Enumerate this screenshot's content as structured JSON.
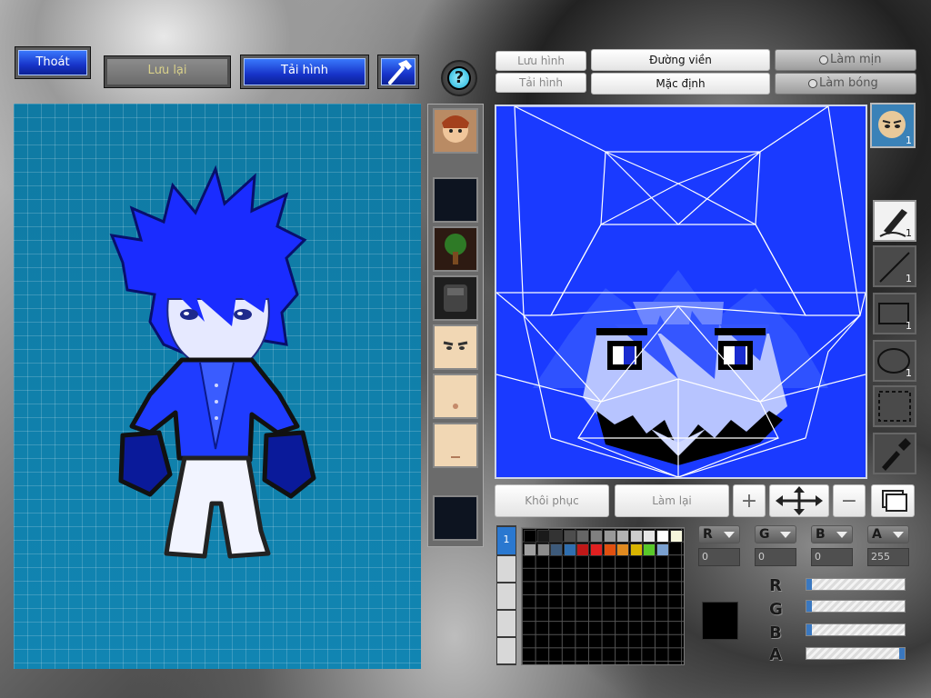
{
  "toolbar": {
    "exit_label": "Thoát",
    "save_label": "Lưu lại",
    "load_label": "Tải hình",
    "help_glyph": "?"
  },
  "editor": {
    "save_image_label": "Lưu hình",
    "load_image_label": "Tải hình",
    "outline_label": "Đường viền",
    "default_label": "Mặc định",
    "smooth_label": "Làm mịn",
    "shadow_label": "Làm bóng",
    "restore_label": "Khôi phục",
    "redo_label": "Làm lại",
    "plus_glyph": "+",
    "minus_glyph": "−"
  },
  "tools": [
    {
      "icon": "pen-icon",
      "count": "1"
    },
    {
      "icon": "line-icon",
      "count": "1"
    },
    {
      "icon": "rectangle-icon",
      "count": "1"
    },
    {
      "icon": "ellipse-icon",
      "count": "1"
    },
    {
      "icon": "selection-icon",
      "count": ""
    },
    {
      "icon": "eyedropper-icon",
      "count": ""
    }
  ],
  "face_badge_count": "1",
  "layer_tab_label": "1",
  "color": {
    "r_label": "R",
    "g_label": "G",
    "b_label": "B",
    "a_label": "A",
    "r_value": "0",
    "g_value": "0",
    "b_value": "0",
    "a_value": "255",
    "r_level": 0,
    "g_level": 0,
    "b_level": 0,
    "a_level": 1.0,
    "current": "#000000"
  },
  "palette": [
    "#000000",
    "#1a1a1a",
    "#333333",
    "#4d4d4d",
    "#666666",
    "#808080",
    "#999999",
    "#b3b3b3",
    "#cccccc",
    "#e6e6e6",
    "#ffffff",
    "#f5f5dc",
    "#a0a0a0",
    "#8c8c8c",
    "#3d5a7a",
    "#2f6fb0",
    "#c01818",
    "#e02020",
    "#e05010",
    "#e08a20",
    "#d8b400",
    "#59c82a",
    "#7aa0d0"
  ],
  "colors": {
    "accent_blue": "#1733c8",
    "canvas_blue": "#1a3aff",
    "grid_teal": "#137da8"
  }
}
